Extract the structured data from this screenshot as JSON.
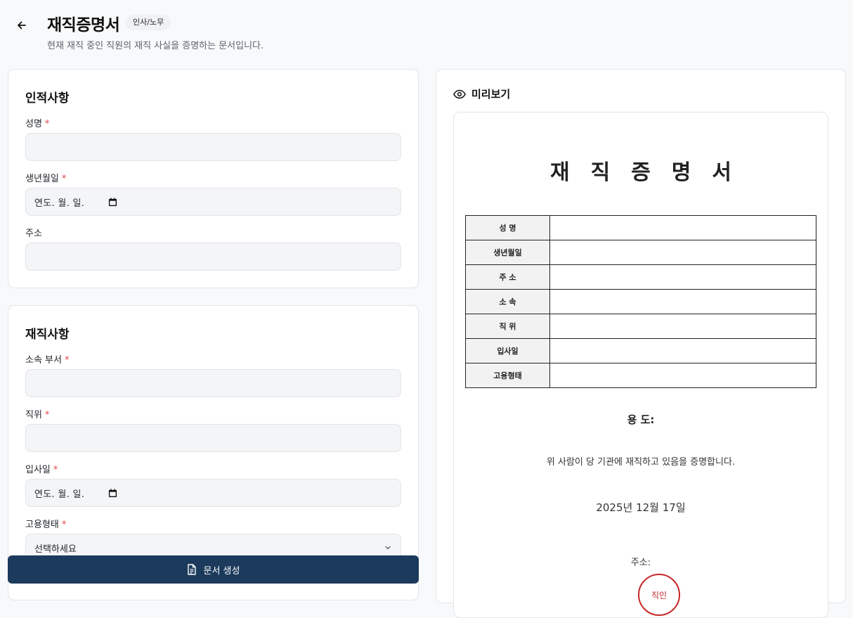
{
  "header": {
    "title": "재직증명서",
    "badge": "인사/노무",
    "subtitle": "현재 재직 중인 직원의 재직 사실을 증명하는 문서입니다."
  },
  "personal": {
    "section_title": "인적사항",
    "name_label": "성명",
    "birth_label": "생년월일",
    "birth_placeholder": "연도. 월. 일.",
    "address_label": "주소",
    "required_mark": "*"
  },
  "employment": {
    "section_title": "재직사항",
    "dept_label": "소속 부서",
    "position_label": "직위",
    "join_label": "입사일",
    "join_placeholder": "연도. 월. 일.",
    "type_label": "고용형태",
    "type_selected": "선택하세요",
    "required_mark": "*"
  },
  "actions": {
    "generate_label": "문서 생성"
  },
  "preview": {
    "heading": "미리보기",
    "doc_title": "재직증명서",
    "table_rows": [
      "성 명",
      "생년월일",
      "주 소",
      "소 속",
      "직 위",
      "입사일",
      "고용형태"
    ],
    "purpose": "용 도:",
    "certify_text": "위 사람이 당 기관에 재직하고 있음을 증명합니다.",
    "date": "2025년 12월 17일",
    "address": "주소:",
    "seal_text": "직인"
  },
  "colors": {
    "primary": "#1b3a5c",
    "required": "#e5484d",
    "seal": "#c62828"
  }
}
